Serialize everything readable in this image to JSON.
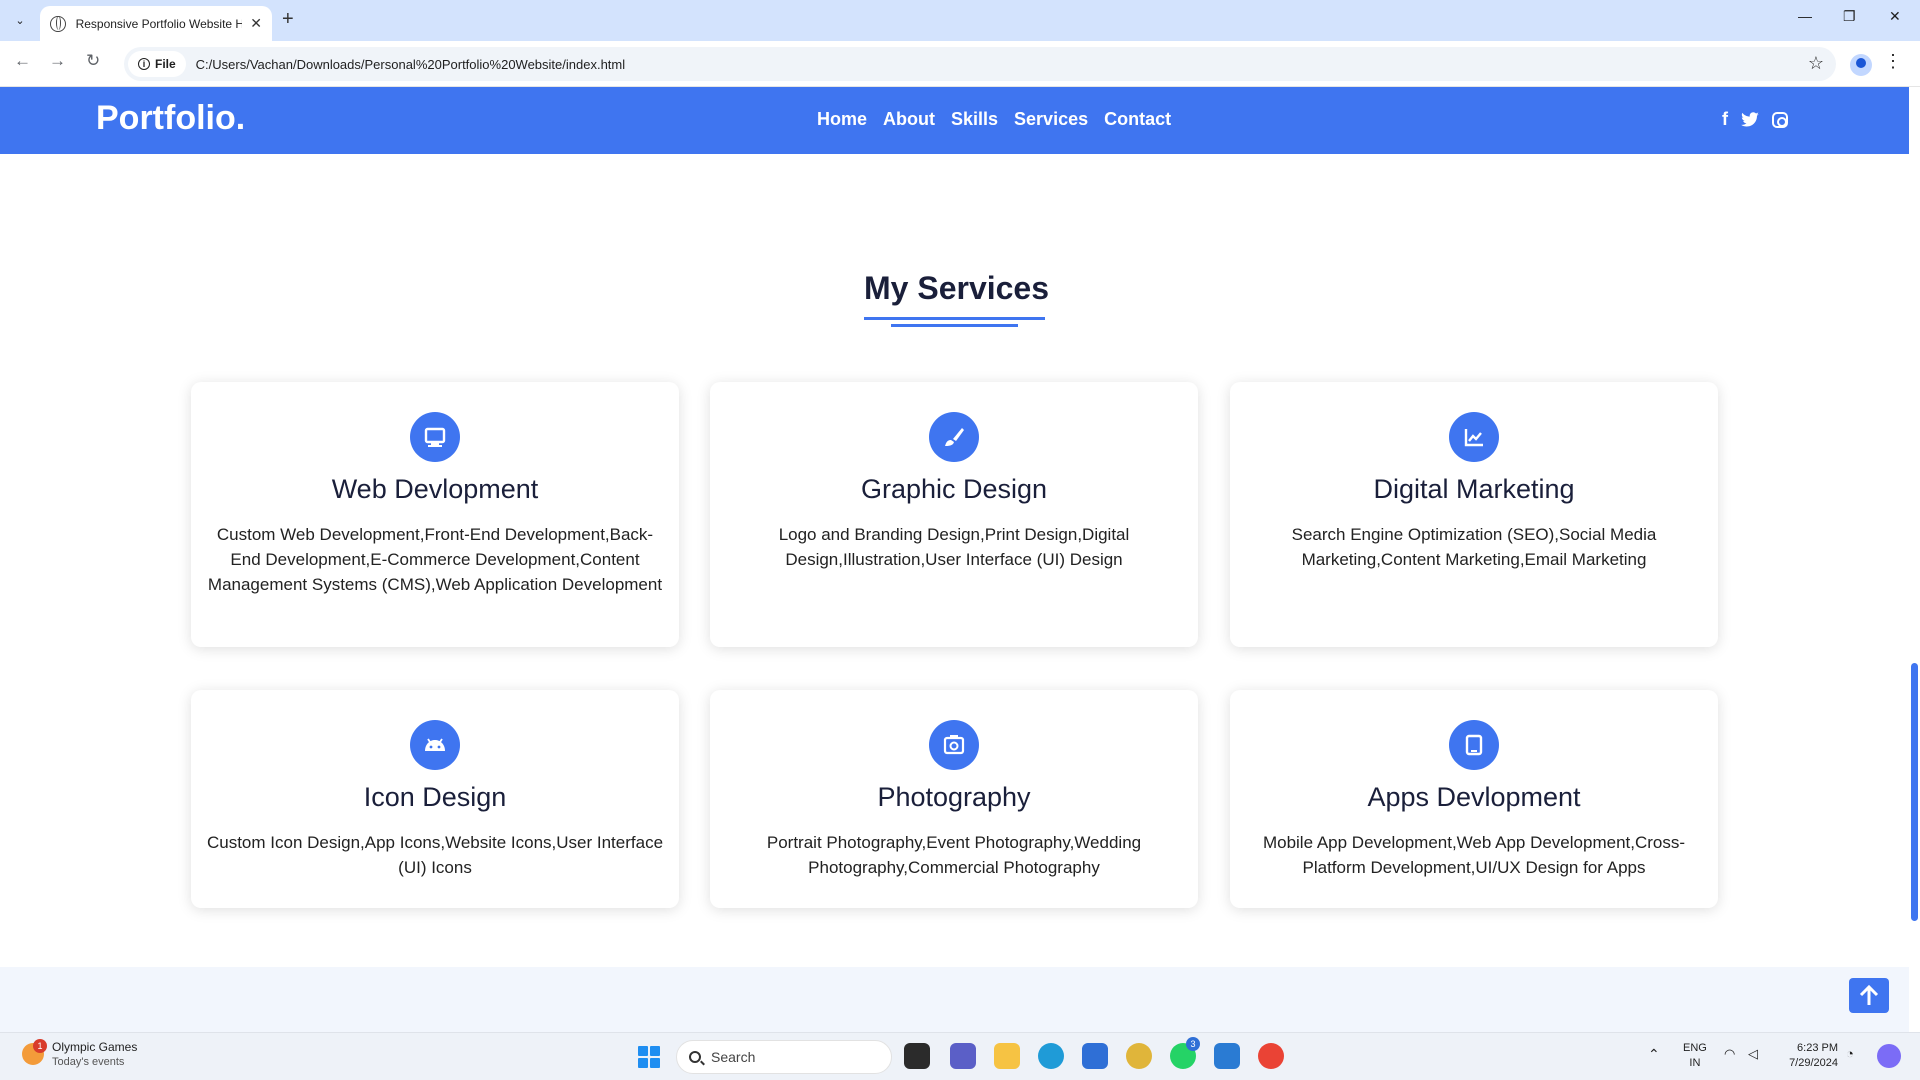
{
  "browser": {
    "tab_title": "Responsive Portfolio Website H",
    "address_chip": "File",
    "url": "C:/Users/Vachan/Downloads/Personal%20Portfolio%20Website/index.html"
  },
  "site": {
    "logo": "Portfolio.",
    "nav": [
      {
        "label": "Home"
      },
      {
        "label": "About"
      },
      {
        "label": "Skills"
      },
      {
        "label": "Services"
      },
      {
        "label": "Contact"
      }
    ],
    "social_icons": [
      "facebook-icon",
      "twitter-icon",
      "instagram-icon"
    ],
    "section_title": "My Services",
    "accent_color": "#3f75f0",
    "services": [
      {
        "title": "Web Devlopment",
        "icon": "monitor-icon",
        "desc": "Custom Web Development,Front-End Development,Back-End Development,E-Commerce Development,Content Management Systems (CMS),Web Application Development"
      },
      {
        "title": "Graphic Design",
        "icon": "paintbrush-icon",
        "desc": "Logo and Branding Design,Print Design,Digital Design,Illustration,User Interface (UI) Design"
      },
      {
        "title": "Digital Marketing",
        "icon": "chart-line-icon",
        "desc": "Search Engine Optimization (SEO),Social Media Marketing,Content Marketing,Email Marketing"
      },
      {
        "title": "Icon Design",
        "icon": "android-icon",
        "desc": "Custom Icon Design,App Icons,Website Icons,User Interface (UI) Icons"
      },
      {
        "title": "Photography",
        "icon": "camera-icon",
        "desc": "Portrait Photography,Event Photography,Wedding Photography,Commercial Photography"
      },
      {
        "title": "Apps Devlopment",
        "icon": "tablet-icon",
        "desc": "Mobile App Development,Web App Development,Cross-Platform Development,UI/UX Design for Apps"
      }
    ]
  },
  "taskbar": {
    "weather_badge": "1",
    "weather_title": "Olympic Games",
    "weather_sub": "Today's events",
    "search_placeholder": "Search",
    "whatsapp_badge": "3",
    "lang_top": "ENG",
    "lang_bottom": "IN",
    "time": "6:23 PM",
    "date": "7/29/2024"
  }
}
